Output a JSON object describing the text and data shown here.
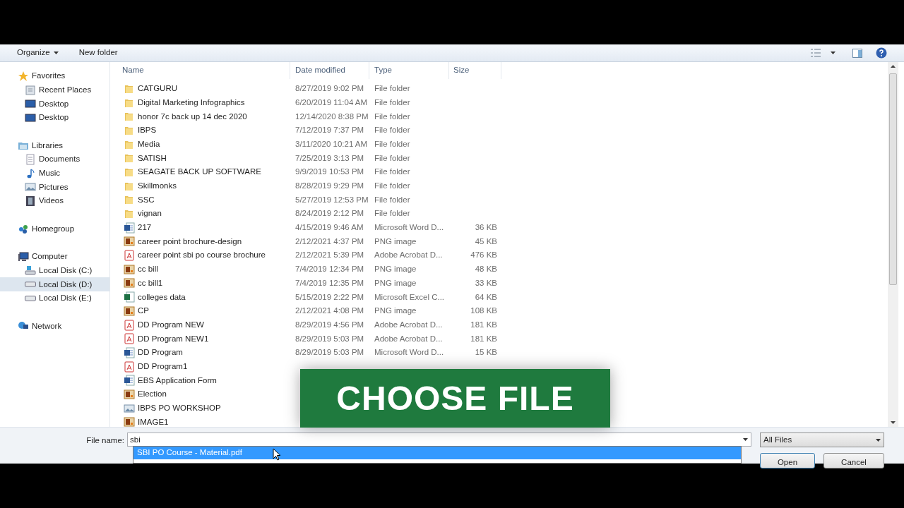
{
  "toolbar": {
    "organize": "Organize",
    "new_folder": "New folder"
  },
  "sidebar": [
    {
      "label": "Favorites",
      "kind": "star",
      "selected": false,
      "children": [
        {
          "label": "Recent Places",
          "kind": "recent",
          "selected": false
        },
        {
          "label": "Desktop",
          "kind": "desktop",
          "selected": false
        },
        {
          "label": "Desktop",
          "kind": "desktop",
          "selected": false
        }
      ]
    },
    {
      "label": "Libraries",
      "kind": "library",
      "selected": false,
      "children": [
        {
          "label": "Documents",
          "kind": "document",
          "selected": false
        },
        {
          "label": "Music",
          "kind": "music",
          "selected": false
        },
        {
          "label": "Pictures",
          "kind": "pictures",
          "selected": false
        },
        {
          "label": "Videos",
          "kind": "videos",
          "selected": false
        }
      ]
    },
    {
      "label": "Homegroup",
      "kind": "homegroup",
      "selected": false
    },
    {
      "label": "Computer",
      "kind": "computer",
      "selected": false,
      "children": [
        {
          "label": "Local Disk (C:)",
          "kind": "system-disk",
          "selected": false
        },
        {
          "label": "Local Disk (D:)",
          "kind": "disk",
          "selected": true
        },
        {
          "label": "Local Disk (E:)",
          "kind": "disk",
          "selected": false
        }
      ]
    },
    {
      "label": "Network",
      "kind": "network",
      "selected": false
    }
  ],
  "table": {
    "columns": [
      "Name",
      "Date modified",
      "Type",
      "Size"
    ],
    "rows": [
      {
        "name": "CATGURU",
        "kind": "folder",
        "date": "8/27/2019 9:02 PM",
        "type": "File folder"
      },
      {
        "name": "Digital Marketing Infographics",
        "kind": "folder",
        "date": "6/20/2019 11:04 AM",
        "type": "File folder"
      },
      {
        "name": "honor 7c back up 14 dec 2020",
        "kind": "folder",
        "date": "12/14/2020 8:38 PM",
        "type": "File folder"
      },
      {
        "name": "IBPS",
        "kind": "folder",
        "date": "7/12/2019 7:37 PM",
        "type": "File folder"
      },
      {
        "name": "Media",
        "kind": "folder",
        "date": "3/11/2020 10:21 AM",
        "type": "File folder"
      },
      {
        "name": "SATISH",
        "kind": "folder",
        "date": "7/25/2019 3:13 PM",
        "type": "File folder"
      },
      {
        "name": "SEAGATE BACK UP SOFTWARE",
        "kind": "folder",
        "date": "9/9/2019 10:53 PM",
        "type": "File folder"
      },
      {
        "name": "Skillmonks",
        "kind": "folder",
        "date": "8/28/2019 9:29 PM",
        "type": "File folder"
      },
      {
        "name": "SSC",
        "kind": "folder",
        "date": "5/27/2019 12:53 PM",
        "type": "File folder"
      },
      {
        "name": "vignan",
        "kind": "folder",
        "date": "8/24/2019 2:12 PM",
        "type": "File folder"
      },
      {
        "name": "217",
        "kind": "word",
        "date": "4/15/2019 9:46 AM",
        "type": "Microsoft Word D...",
        "size": "36 KB"
      },
      {
        "name": "career point brochure-design",
        "kind": "png",
        "date": "2/12/2021 4:37 PM",
        "type": "PNG image",
        "size": "45 KB"
      },
      {
        "name": "career point sbi po course brochure",
        "kind": "pdf",
        "date": "2/12/2021 5:39 PM",
        "type": "Adobe Acrobat D...",
        "size": "476 KB"
      },
      {
        "name": "cc bill",
        "kind": "png",
        "date": "7/4/2019 12:34 PM",
        "type": "PNG image",
        "size": "48 KB"
      },
      {
        "name": "cc bill1",
        "kind": "png",
        "date": "7/4/2019 12:35 PM",
        "type": "PNG image",
        "size": "33 KB"
      },
      {
        "name": "colleges data",
        "kind": "excel",
        "date": "5/15/2019 2:22 PM",
        "type": "Microsoft Excel C...",
        "size": "64 KB"
      },
      {
        "name": "CP",
        "kind": "png",
        "date": "2/12/2021 4:08 PM",
        "type": "PNG image",
        "size": "108 KB"
      },
      {
        "name": "DD Program NEW",
        "kind": "pdf",
        "date": "8/29/2019 4:56 PM",
        "type": "Adobe Acrobat D...",
        "size": "181 KB"
      },
      {
        "name": "DD Program NEW1",
        "kind": "pdf",
        "date": "8/29/2019 5:03 PM",
        "type": "Adobe Acrobat D...",
        "size": "181 KB"
      },
      {
        "name": "DD Program",
        "kind": "word",
        "date": "8/29/2019 5:03 PM",
        "type": "Microsoft Word D...",
        "size": "15 KB"
      },
      {
        "name": "DD Program1",
        "kind": "pdf"
      },
      {
        "name": "EBS Application Form",
        "kind": "word"
      },
      {
        "name": "Election",
        "kind": "png"
      },
      {
        "name": "IBPS PO WORKSHOP",
        "kind": "bitmap"
      },
      {
        "name": "IMAGE1",
        "kind": "png"
      }
    ]
  },
  "banner": "CHOOSE FILE",
  "file_name": {
    "label": "File name:",
    "value": "sbi",
    "suggestions": [
      {
        "text": "SBI PO Course - Material.pdf",
        "selected": true
      }
    ]
  },
  "filter": "All Files",
  "buttons": [
    "Open",
    "Cancel"
  ]
}
